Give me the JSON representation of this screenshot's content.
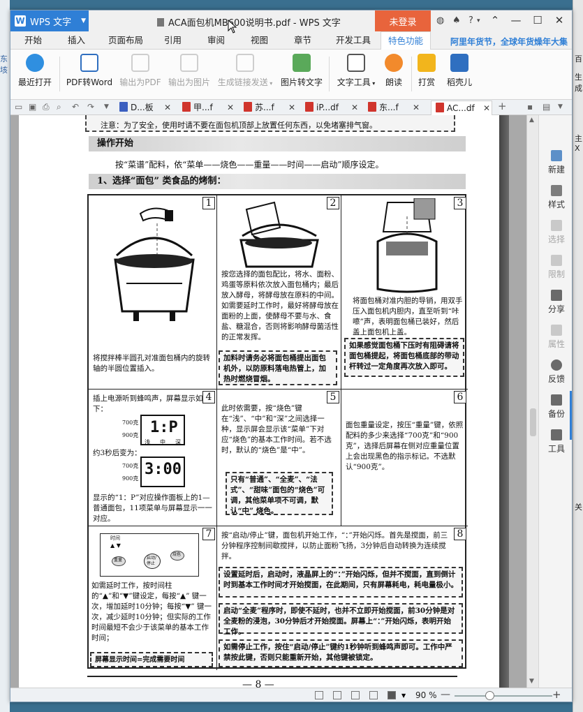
{
  "desktop": {
    "left_fragments": [
      "东垓",
      "管"
    ],
    "right_fragments": [
      "百",
      "生成",
      "主X",
      "关"
    ]
  },
  "app": {
    "name": "WPS 文字",
    "title": "ACA面包机MB600说明书.pdf - WPS 文字",
    "login": "未登录",
    "help": "?"
  },
  "menu": {
    "tabs": [
      "开始",
      "插入",
      "页面布局",
      "引用",
      "审阅",
      "视图",
      "章节",
      "开发工具",
      "特色功能"
    ],
    "active": "特色功能",
    "promo": "阿里年货节，全球年货燥年大集"
  },
  "ribbon": {
    "recent": "最近打开",
    "pdf_to_word": "PDF转Word",
    "export_pdf": "输出为PDF",
    "export_image": "输出为图片",
    "share_link": "生成链接发送",
    "img_to_text": "图片转文字",
    "text_tools": "文字工具",
    "read_aloud": "朗读",
    "reward": "打赏",
    "daoke": "稻壳儿"
  },
  "doc_tabs": [
    {
      "label": "D...板",
      "color": "#3b5fc0"
    },
    {
      "label": "甲...f",
      "color": "#d0352d"
    },
    {
      "label": "苏...f",
      "color": "#d0352d"
    },
    {
      "label": "iP...df",
      "color": "#d0352d"
    },
    {
      "label": "东...f",
      "color": "#d0352d"
    },
    {
      "label": "AC...df",
      "color": "#d0352d"
    }
  ],
  "side_pane": [
    {
      "label": "新建",
      "enabled": true
    },
    {
      "label": "样式",
      "enabled": true
    },
    {
      "label": "选择",
      "enabled": false
    },
    {
      "label": "限制",
      "enabled": false
    },
    {
      "label": "分享",
      "enabled": true
    },
    {
      "label": "属性",
      "enabled": false
    },
    {
      "label": "反馈",
      "enabled": true
    },
    {
      "label": "备份",
      "enabled": true
    },
    {
      "label": "工具",
      "enabled": true
    }
  ],
  "status": {
    "zoom": "90 %",
    "zoom_fraction": 0.36
  },
  "page": {
    "note_top": "注意：为了安全，使用时请不要在面包机顶部上放置任何东西，以免堵塞排气窗。",
    "section_title": "操作开始",
    "intro": "按“菜谱”配料，依“菜单——烧色——重量——时间——启动”顺序设定。",
    "subsection": "1、选择“面包” 类食品的烤制：",
    "step1_text": "将搅拌棒半圆孔对准面包桶内的旋转轴的半圆位置插入。",
    "step2_text": "按您选择的面包配比，将水、面粉、鸡蛋等原料依次放入面包桶内；最后放入酵母，将酵母放在原料的中间。如需要延时工作时，最好将酵母放在面粉的上面，使酵母不要与水、食盐、糖混合，否则将影响酵母菌活性的正常发挥。",
    "step2_box": "加料时请务必将面包桶提出面包机外，以防原料落电热管上，加热时燃烧冒烟。",
    "step3_text": "将面包桶对准内胆的导销，用双手压入面包机内胆内，直至听到“咔嚓”声，表明面包桶已装好，然后盖上面包机上盖。",
    "step3_box": "如果感觉面包桶下压时有阻碍请将面包桶提起，将面包桶底部的带动杆转过一定角度再次放入即可。",
    "step4_text1": "插上电源听到蜂鸣声，屏幕显示如下：",
    "step4_text2": "约3秒后变为：",
    "step4_text3": "显示的“1：P”对应操作面板上的1—普通面包，11项菜单与屏幕显示一一对应。",
    "lcd1": "1:P",
    "lcd2": "3:00",
    "lcd_w700": "700克",
    "lcd_w900": "900克",
    "lcd_light": "浅",
    "lcd_mid": "中",
    "lcd_dark": "深",
    "step5_text": "此时依需要，按“烧色”键在“浅”、“中”和“深”之间选择一种，显示屏会显示该“菜单”下对应“烧色”的基本工作时间。若不选时，默认的“烧色”是“中”。",
    "step5_box": "只有“普通”、“全麦”、“法式”、“甜味”面包的“烧色”可调，其他菜单项不可调，默认“中” 烧色。",
    "step6_text": "面包重量设定，按压“重量”键，依照配料的多少来选择“700克”和“900克”，选择后屏幕在侧对应重量位置上会出现黑色的指示标记。不选默认“900克”。",
    "panel_time": "时间",
    "panel_weight": "重量",
    "panel_start": "启动/停止",
    "panel_color": "烧色",
    "step7_text": "如需延时工作，按时间柱的“▲”和“▼”键设定，每按“▲” 键一次，增加延时10分钟；每按“▼” 键一次，减少延时10分钟；但实际的工作时间最短不会少于该菜单的基本工作时间；",
    "step7_box": "屏幕显示时间=完成需要时间",
    "step8_text": "按“启动/停止”键，面包机开始工作，“：”开始闪烁。首先是搅面，前三分钟程序控制间歇搅拌，以防止面粉飞扬，3分钟后自动转换为连续搅拌。",
    "step8_box1": "设置延时后，启动时，液晶屏上的“：”开始闪烁，但并不搅面，直到倒计时到基本工作时间才开始搅面，在此期间，只有屏幕耗电，耗电量极小。",
    "step8_box2": "启动“全麦”程序时，即使不延时，也并不立即开始搅面，前30分钟是对全麦粉的浸泡，30分钟后才开始搅面。屏幕上“：”开始闪烁，表明开始工作。",
    "step8_box3": "如需停止工作，按住“启动/停止”键约1秒钟听到蜂鸣声即可。工作中严禁按此键，否则只能重新开始，其他键被锁定。",
    "page_number": "— 8 —",
    "n1": "1",
    "n2": "2",
    "n3": "3",
    "n4": "4",
    "n5": "5",
    "n6": "6",
    "n7": "7",
    "n8": "8"
  }
}
